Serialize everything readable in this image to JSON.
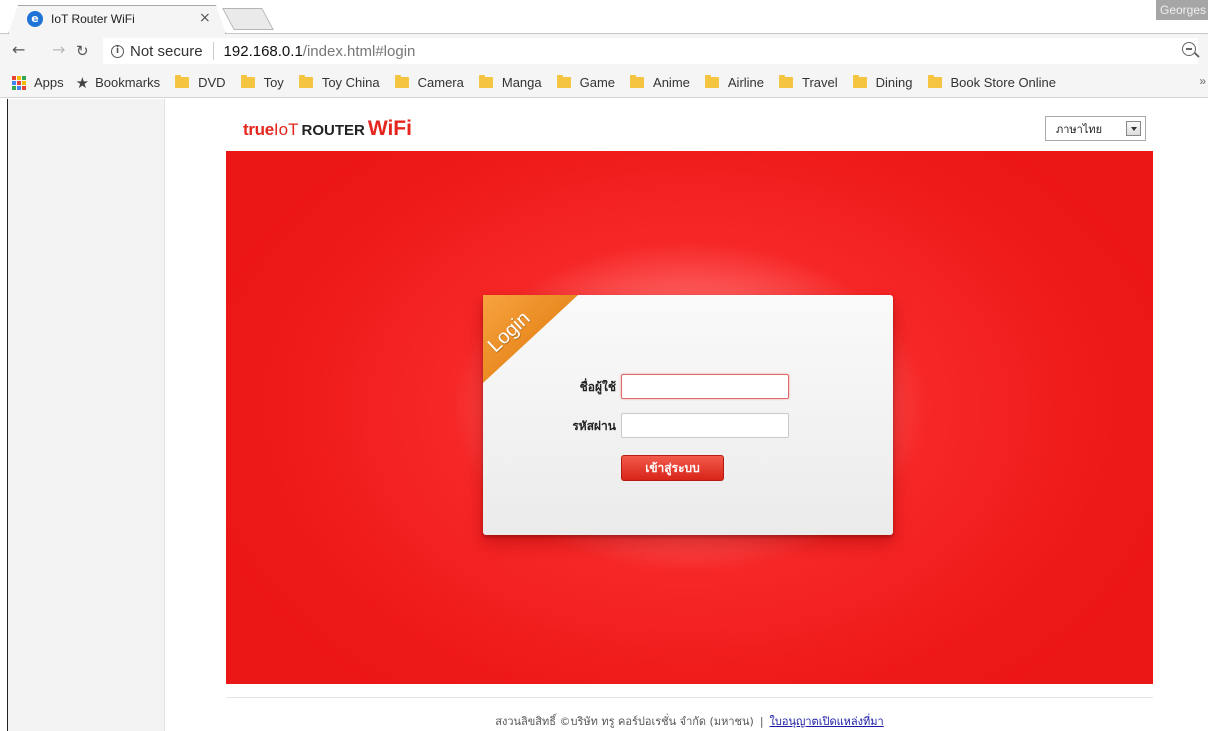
{
  "browser": {
    "tab_title": "IoT Router WiFi",
    "tab_close": "×",
    "profile_name": "Georges",
    "not_secure": "Not secure",
    "url_host": "192.168.0.1",
    "url_path": "/index.html#login"
  },
  "bookmarks": {
    "apps": "Apps",
    "bookmarks": "Bookmarks",
    "folders": [
      "DVD",
      "Toy",
      "Toy China",
      "Camera",
      "Manga",
      "Game",
      "Anime",
      "Airline",
      "Travel",
      "Dining",
      "Book Store Online"
    ],
    "more": "»"
  },
  "page": {
    "logo_true": "true",
    "logo_iot": "IoT",
    "logo_router": "ROUTER",
    "logo_wifi": "WiFi",
    "language_selected": "ภาษาไทย",
    "login_corner": "Login",
    "username_label": "ชื่อผู้ใช้",
    "password_label": "รหัสผ่าน",
    "username_value": "",
    "password_value": "",
    "login_button": "เข้าสู่ระบบ",
    "footer_copyright": "สงวนลิขสิทธิ์ ©บริษัท ทรู คอร์ปอเรชั่น จำกัด (มหาชน)",
    "footer_separator": "|",
    "footer_link": "ใบอนุญาตเปิดแหล่งที่มา"
  },
  "colors": {
    "brand_red": "#e4261f",
    "corner_orange": "#e8891f",
    "bookmark_folder": "#f5c441"
  }
}
